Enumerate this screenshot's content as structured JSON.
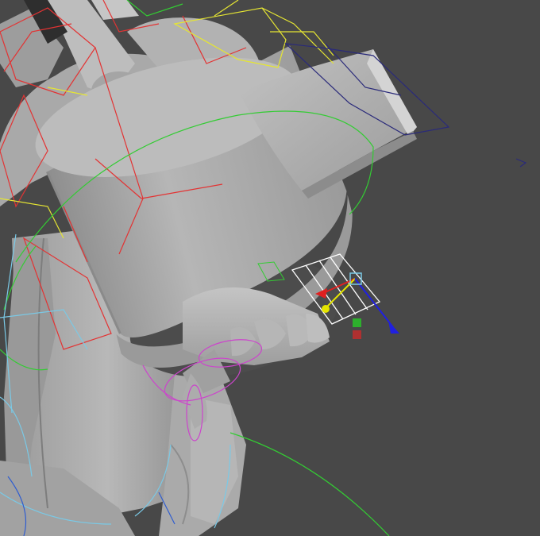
{
  "viewport": {
    "background_color": "#484848",
    "model_color": "#b4b4b4",
    "shading": "smooth-shaded",
    "rig_curve_colors": {
      "red": "#e33333",
      "yellow": "#e5e533",
      "green": "#33cc33",
      "navy": "#2a2a7a",
      "cyan": "#7ac9e6",
      "magenta": "#cc44cc",
      "white": "#ffffff"
    },
    "manipulator": {
      "type": "move",
      "x_axis_color": "#e02020",
      "y_axis_color": "#e5e500",
      "z_axis_color": "#2020e0",
      "center_handle_color": "#7ac9e6"
    }
  }
}
